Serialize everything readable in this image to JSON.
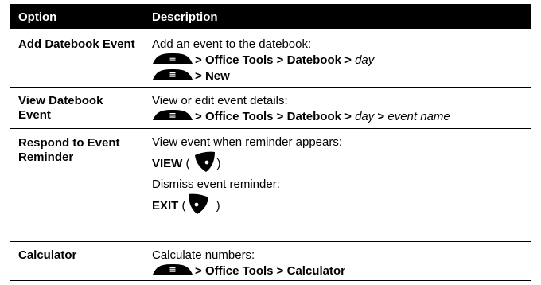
{
  "header": {
    "option": "Option",
    "description": "Description"
  },
  "rows": [
    {
      "option": "Add Datebook Event",
      "desc_line1": "Add an event to the datebook:",
      "path1": {
        "sep1": "> ",
        "a": "Office Tools",
        "sep2": " > ",
        "b": "Datebook",
        "sep3": " > ",
        "c": "day"
      },
      "path2": {
        "sep1": "> ",
        "a": "New"
      }
    },
    {
      "option": "View Datebook Event",
      "desc_line1": "View or edit event details:",
      "path1": {
        "sep1": "> ",
        "a": "Office Tools",
        "sep2": " > ",
        "b": "Datebook",
        "sep3": " > ",
        "c": "day",
        "sep4": " > ",
        "d": "event name"
      }
    },
    {
      "option": "Respond to Event Reminder",
      "desc_line1": "View event when reminder appears:",
      "key1_label": "VIEW",
      "key1_open": " (",
      "key1_close": ")",
      "desc_line2": "Dismiss event reminder:",
      "key2_label": "EXIT",
      "key2_open": " (",
      "key2_close": " )"
    },
    {
      "option": "Calculator",
      "desc_line1": "Calculate numbers:",
      "path1": {
        "sep1": "> ",
        "a": "Office Tools",
        "sep2": " > ",
        "b": "Calculator"
      }
    }
  ],
  "icons": {
    "menu_key": "menu-key-icon",
    "right_soft_key": "right-soft-key-icon",
    "left_soft_key": "left-soft-key-icon"
  }
}
